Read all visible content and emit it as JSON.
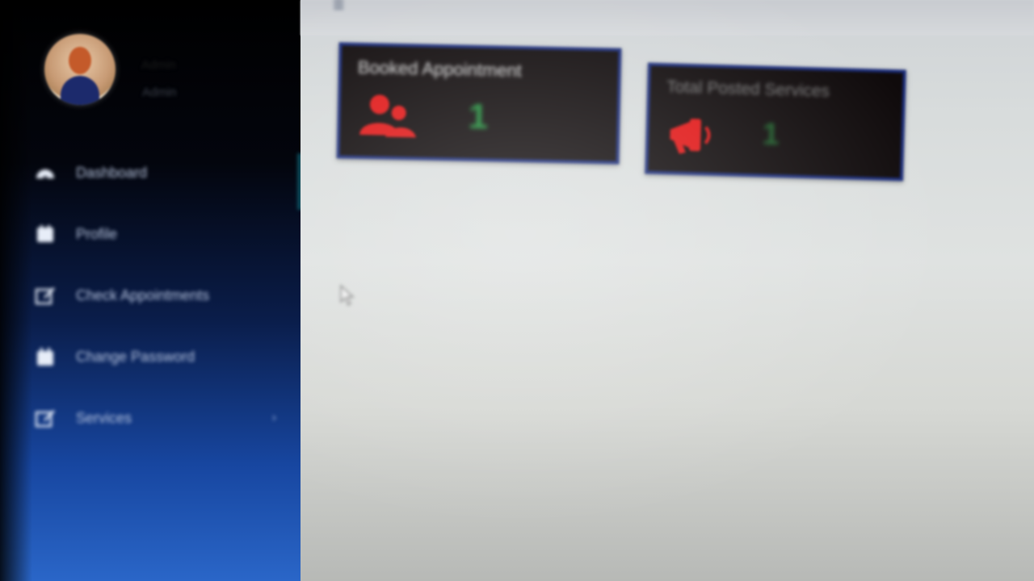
{
  "sidebar": {
    "user": {
      "name": "Admin",
      "role": "Admin"
    },
    "items": [
      {
        "label": "Dashboard",
        "icon": "dashboard-icon"
      },
      {
        "label": "Profile",
        "icon": "profile-icon"
      },
      {
        "label": "Check Appointments",
        "icon": "edit-icon"
      },
      {
        "label": "Change Password",
        "icon": "lock-icon"
      },
      {
        "label": "Services",
        "icon": "edit-icon"
      }
    ]
  },
  "main": {
    "cards": [
      {
        "title": "Booked Appointment",
        "value": "1",
        "icon": "users-icon",
        "icon_color": "#e01515",
        "value_color": "#1f8f3a"
      },
      {
        "title": "Total Posted Services",
        "value": "1",
        "icon": "megaphone-icon",
        "icon_color": "#e01515",
        "value_color": "#1d5f2a"
      }
    ]
  },
  "colors": {
    "sidebar_top": "#000000",
    "sidebar_bottom": "#2a66c8",
    "card_bg": "#0f0a0b",
    "card_border": "#1a2c7a"
  }
}
